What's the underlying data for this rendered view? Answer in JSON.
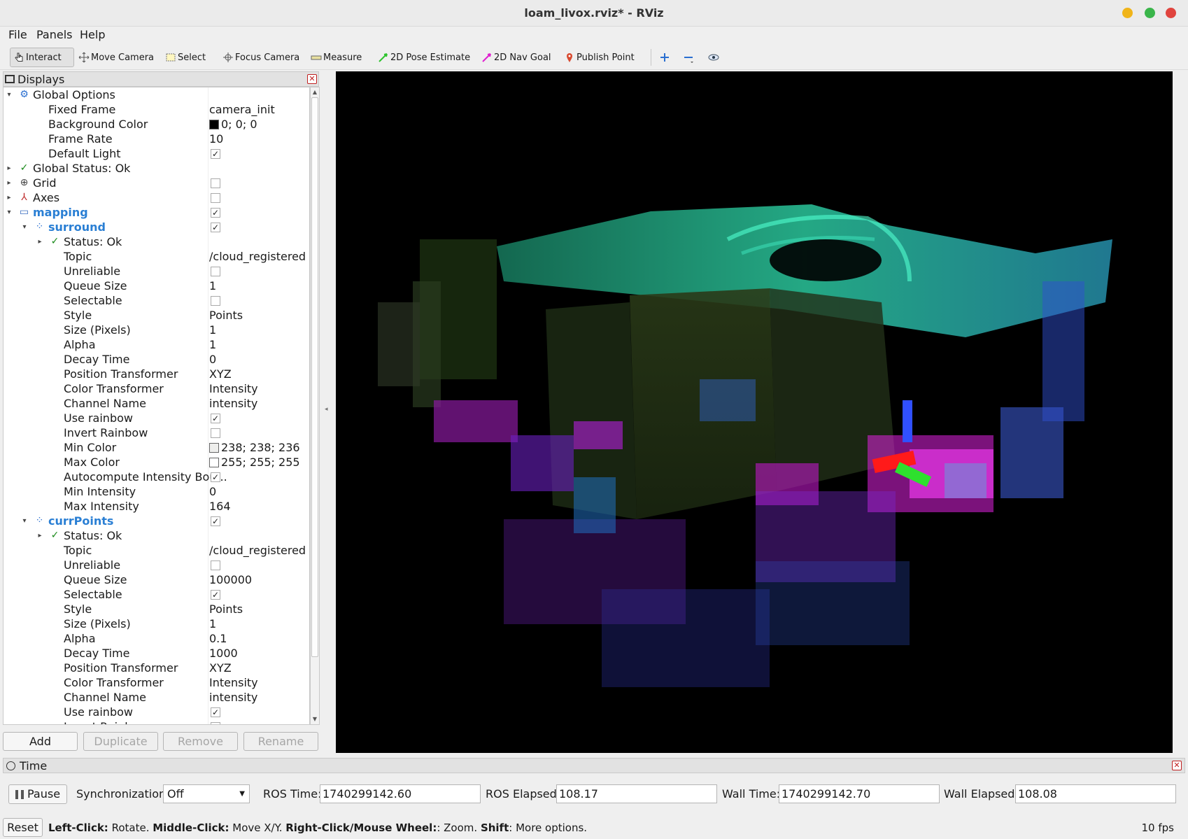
{
  "window": {
    "title": "loam_livox.rviz* - RViz"
  },
  "menu": [
    "File",
    "Panels",
    "Help"
  ],
  "toolbar": {
    "interact": "Interact",
    "move_camera": "Move Camera",
    "select": "Select",
    "focus_camera": "Focus Camera",
    "measure": "Measure",
    "pose_estimate": "2D Pose Estimate",
    "nav_goal": "2D Nav Goal",
    "publish_point": "Publish Point"
  },
  "displays": {
    "title": "Displays",
    "rows": [
      {
        "exp": "▾",
        "icon": "gear-icon",
        "name": "Global Options",
        "indent": 0
      },
      {
        "name": "Fixed Frame",
        "value": "camera_init",
        "indent": 1
      },
      {
        "name": "Background Color",
        "value": "0; 0; 0",
        "swatch": "#000000",
        "indent": 1
      },
      {
        "name": "Frame Rate",
        "value": "10",
        "indent": 1
      },
      {
        "name": "Default Light",
        "check": true,
        "indent": 1
      },
      {
        "exp": "▸",
        "icon": "check-icon",
        "name": "Global Status: Ok",
        "indent": 0
      },
      {
        "exp": "▸",
        "icon": "grid-icon",
        "name": "Grid",
        "check": false,
        "indent": 0
      },
      {
        "exp": "▸",
        "icon": "axes-icon",
        "name": "Axes",
        "check": false,
        "indent": 0
      },
      {
        "exp": "▾",
        "icon": "folder-icon",
        "name": "mapping",
        "check": true,
        "group": true,
        "indent": 0
      },
      {
        "exp": "▾",
        "icon": "pointcloud-icon",
        "name": "surround",
        "check": true,
        "group": true,
        "indent": 1
      },
      {
        "exp": "▸",
        "icon": "check-icon",
        "name": "Status: Ok",
        "indent": 2
      },
      {
        "name": "Topic",
        "value": "/cloud_registered",
        "indent": 2
      },
      {
        "name": "Unreliable",
        "check": false,
        "indent": 2
      },
      {
        "name": "Queue Size",
        "value": "1",
        "indent": 2
      },
      {
        "name": "Selectable",
        "check": false,
        "indent": 2
      },
      {
        "name": "Style",
        "value": "Points",
        "indent": 2
      },
      {
        "name": "Size (Pixels)",
        "value": "1",
        "indent": 2
      },
      {
        "name": "Alpha",
        "value": "1",
        "indent": 2
      },
      {
        "name": "Decay Time",
        "value": "0",
        "indent": 2
      },
      {
        "name": "Position Transformer",
        "value": "XYZ",
        "indent": 2
      },
      {
        "name": "Color Transformer",
        "value": "Intensity",
        "indent": 2
      },
      {
        "name": "Channel Name",
        "value": "intensity",
        "indent": 2
      },
      {
        "name": "Use rainbow",
        "check": true,
        "indent": 2
      },
      {
        "name": "Invert Rainbow",
        "check": false,
        "indent": 2
      },
      {
        "name": "Min Color",
        "value": "238; 238; 236",
        "swatch": "#eeeeec",
        "indent": 2
      },
      {
        "name": "Max Color",
        "value": "255; 255; 255",
        "swatch": "#ffffff",
        "indent": 2
      },
      {
        "name": "Autocompute Intensity Bou...",
        "check": true,
        "indent": 2
      },
      {
        "name": "Min Intensity",
        "value": "0",
        "indent": 2
      },
      {
        "name": "Max Intensity",
        "value": "164",
        "indent": 2
      },
      {
        "exp": "▾",
        "icon": "pointcloud-icon",
        "name": "currPoints",
        "check": true,
        "group": true,
        "indent": 1
      },
      {
        "exp": "▸",
        "icon": "check-icon",
        "name": "Status: Ok",
        "indent": 2
      },
      {
        "name": "Topic",
        "value": "/cloud_registered",
        "indent": 2
      },
      {
        "name": "Unreliable",
        "check": false,
        "indent": 2
      },
      {
        "name": "Queue Size",
        "value": "100000",
        "indent": 2
      },
      {
        "name": "Selectable",
        "check": true,
        "indent": 2
      },
      {
        "name": "Style",
        "value": "Points",
        "indent": 2
      },
      {
        "name": "Size (Pixels)",
        "value": "1",
        "indent": 2
      },
      {
        "name": "Alpha",
        "value": "0.1",
        "indent": 2
      },
      {
        "name": "Decay Time",
        "value": "1000",
        "indent": 2
      },
      {
        "name": "Position Transformer",
        "value": "XYZ",
        "indent": 2
      },
      {
        "name": "Color Transformer",
        "value": "Intensity",
        "indent": 2
      },
      {
        "name": "Channel Name",
        "value": "intensity",
        "indent": 2
      },
      {
        "name": "Use rainbow",
        "check": true,
        "indent": 2
      },
      {
        "name": "Invert Rainbow",
        "check": false,
        "indent": 2
      }
    ],
    "buttons": {
      "add": "Add",
      "duplicate": "Duplicate",
      "remove": "Remove",
      "rename": "Rename"
    }
  },
  "time": {
    "title": "Time",
    "pause": "Pause",
    "sync_label": "Synchronization:",
    "sync_value": "Off",
    "ros_time_label": "ROS Time:",
    "ros_time": "1740299142.60",
    "ros_elapsed_label": "ROS Elapsed:",
    "ros_elapsed": "108.17",
    "wall_time_label": "Wall Time:",
    "wall_time": "1740299142.70",
    "wall_elapsed_label": "Wall Elapsed:",
    "wall_elapsed": "108.08"
  },
  "status": {
    "reset": "Reset",
    "left_click": "Left-Click:",
    "left_click_desc": " Rotate. ",
    "middle_click": "Middle-Click:",
    "middle_click_desc": " Move X/Y. ",
    "right_click": "Right-Click/Mouse Wheel:",
    "right_click_desc": ": Zoom. ",
    "shift": "Shift",
    "shift_desc": ": More options.",
    "fps": "10 fps"
  },
  "colors": {
    "accent_group": "#2a7fd4",
    "view_background": "#000000",
    "close_red": "#c02020"
  }
}
